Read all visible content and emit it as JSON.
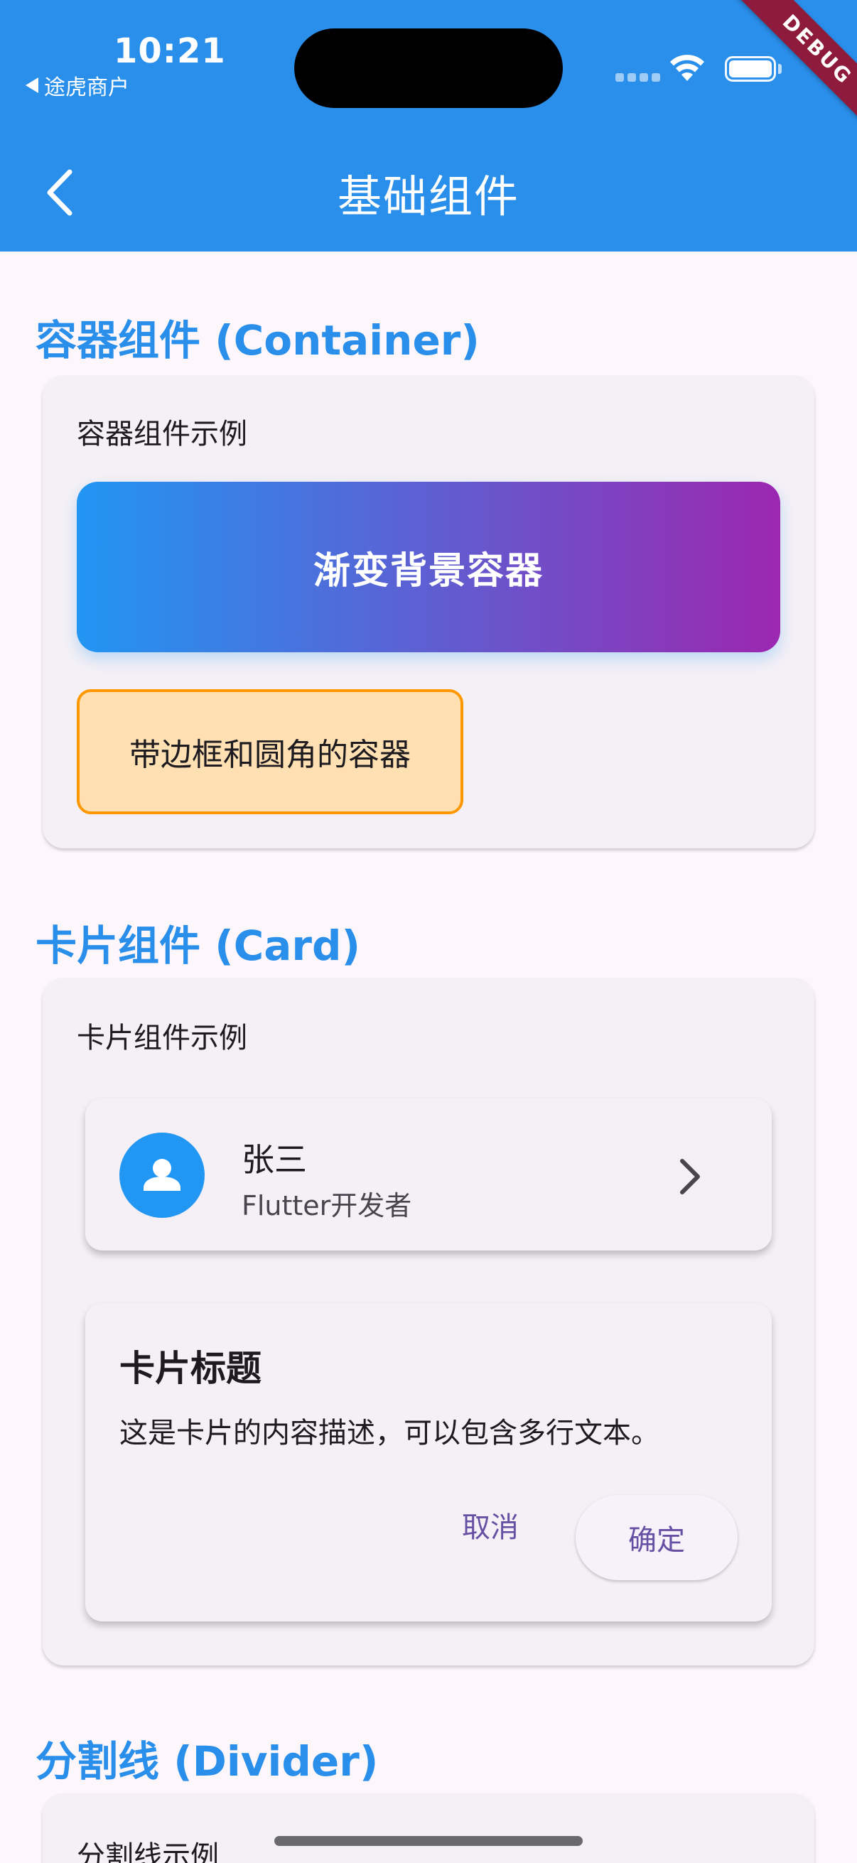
{
  "status_bar": {
    "time": "10:21",
    "back_app": "途虎商户",
    "debug_banner": "DEBUG"
  },
  "header": {
    "title": "基础组件",
    "back_icon": "chevron-left-icon"
  },
  "sections": {
    "container": {
      "heading": "容器组件 (Container)",
      "caption": "容器组件示例",
      "gradient_label": "渐变背景容器",
      "bordered_label": "带边框和圆角的容器",
      "gradient_colors": [
        "#2196f3",
        "#9c27b0"
      ],
      "border_color": "#ff9800",
      "fill_color": "#ffe0b2"
    },
    "card": {
      "heading": "卡片组件 (Card)",
      "caption": "卡片组件示例",
      "list_tile": {
        "name": "张三",
        "subtitle": "Flutter开发者",
        "leading_icon": "person-icon",
        "trailing_icon": "chevron-right-icon"
      },
      "content_card": {
        "title": "卡片标题",
        "body": "这是卡片的内容描述，可以包含多行文本。",
        "cancel_label": "取消",
        "confirm_label": "确定"
      }
    },
    "divider": {
      "heading": "分割线 (Divider)",
      "caption": "分割线示例"
    }
  },
  "colors": {
    "primary": "#2a8fea",
    "button_text": "#6750a4"
  }
}
